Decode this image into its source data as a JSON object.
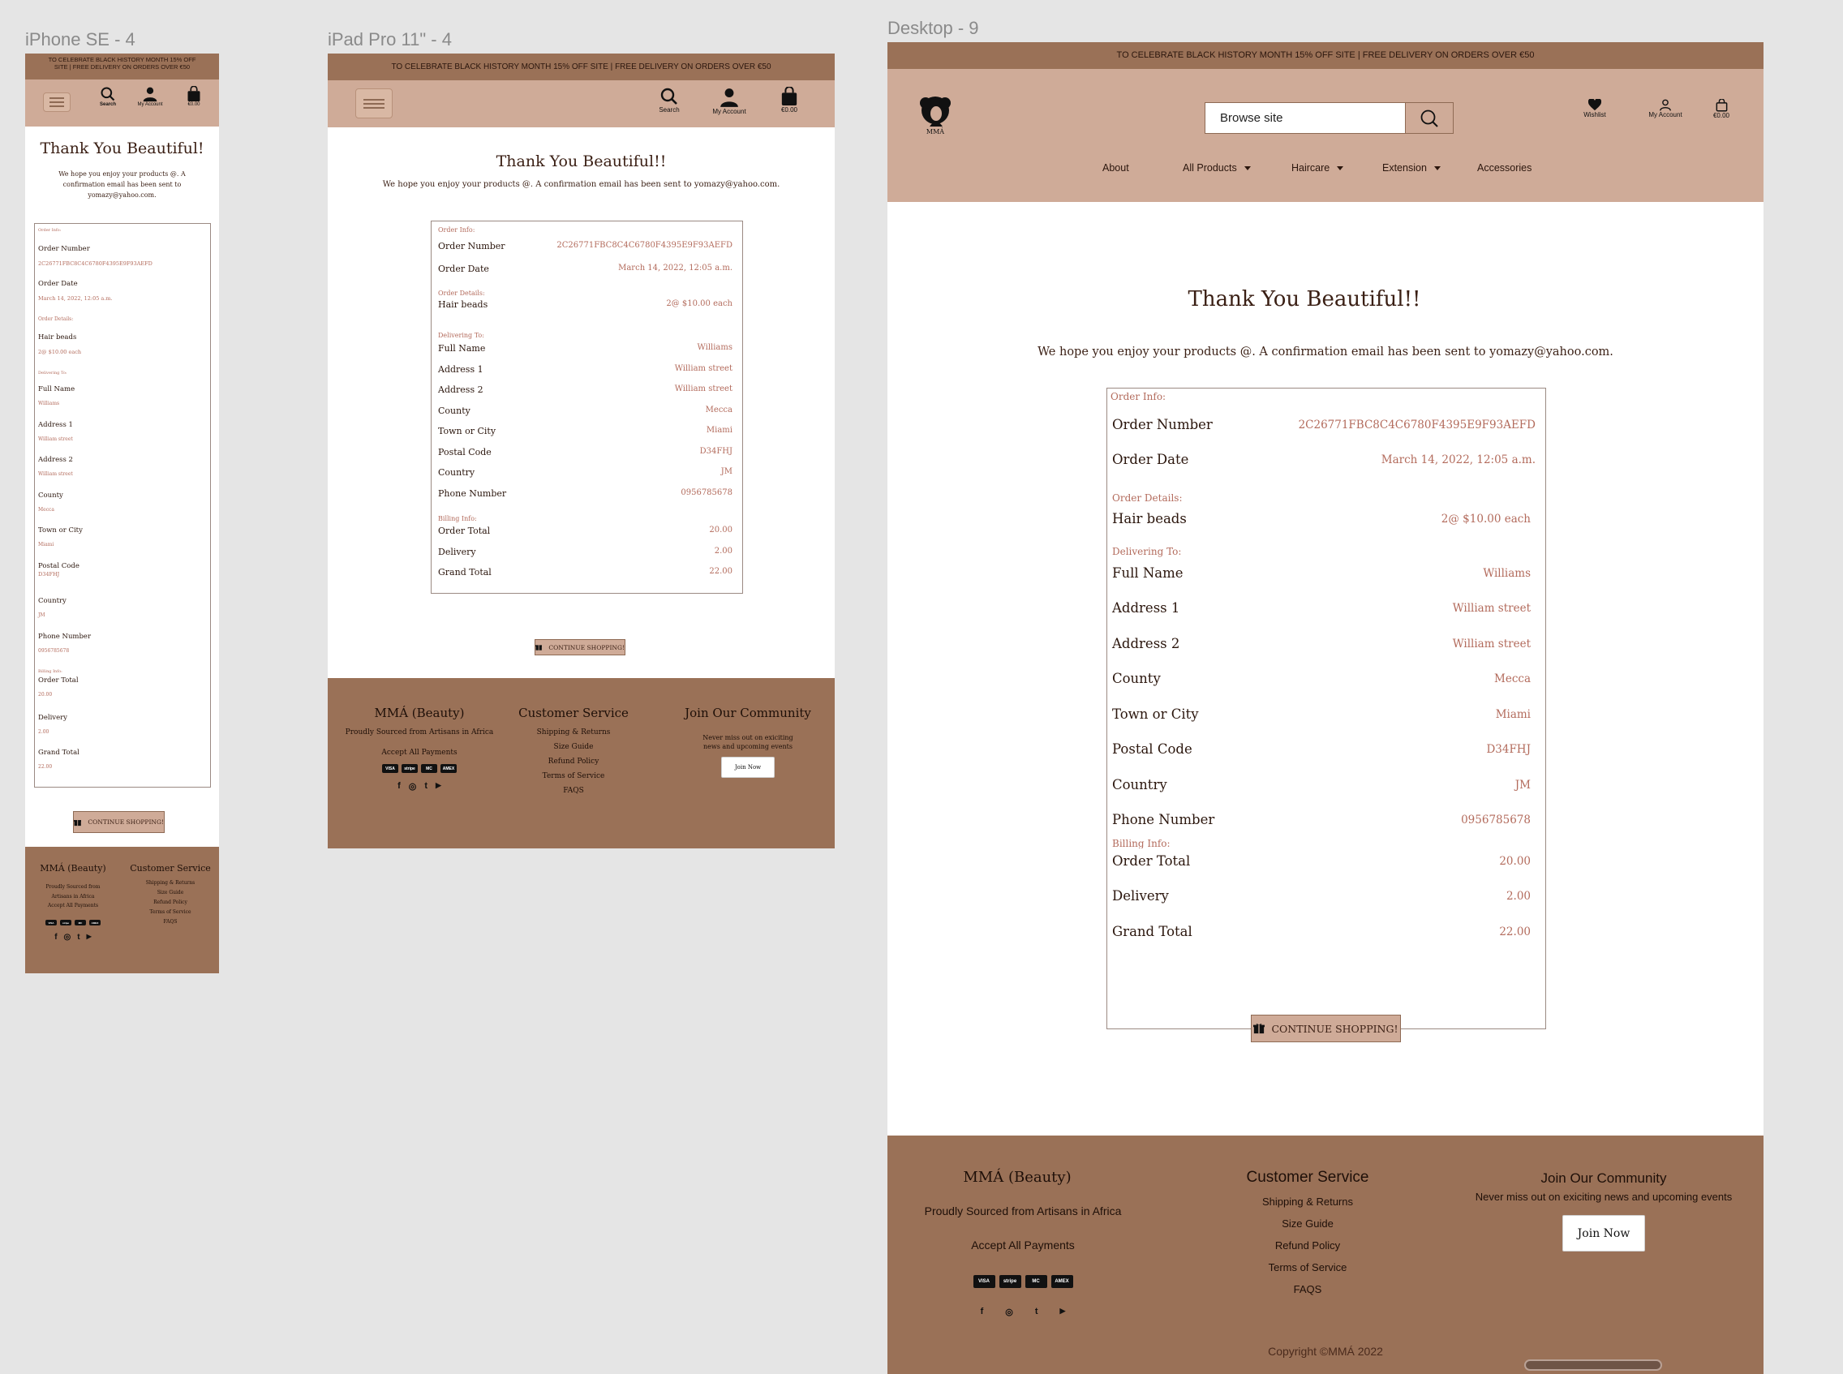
{
  "frames": {
    "mobile": "iPhone SE - 4",
    "tablet": "iPad Pro 11\" - 4",
    "desktop": "Desktop - 9"
  },
  "promo": "TO CELEBRATE BLACK HISTORY MONTH 15% OFF SITE | FREE DELIVERY ON ORDERS OVER €50",
  "header": {
    "search_label": "Search",
    "account_label": "My Account",
    "cart_total": "€0.00",
    "wishlist_label": "Wishlist",
    "search_placeholder": "Browse site",
    "logo_text": "MMÁ"
  },
  "nav": [
    {
      "label": "About",
      "dropdown": false
    },
    {
      "label": "All Products",
      "dropdown": true
    },
    {
      "label": "Haircare",
      "dropdown": true
    },
    {
      "label": "Extension",
      "dropdown": true
    },
    {
      "label": "Accessories",
      "dropdown": false
    }
  ],
  "confirmation": {
    "title": "Thank You Beautiful!!",
    "title_mobile": "Thank You Beautiful!",
    "message": "We hope you enjoy your products @. A confirmation email has been sent to yomazy@yahoo.com."
  },
  "order": {
    "order_info_label": "Order Info:",
    "order_details_label": "Order Details:",
    "delivering_label": "Delivering To:",
    "billing_label": "Billing Info:",
    "order_number_label": "Order Number",
    "order_number": "2C26771FBC8C4C6780F4395E9F93AEFD",
    "order_date_label": "Order Date",
    "order_date": "March 14, 2022, 12:05 a.m.",
    "item_name": "Hair beads",
    "item_qty": "2@ $10.00 each",
    "full_name_label": "Full Name",
    "full_name": "Williams",
    "address1_label": "Address 1",
    "address1": "William street",
    "address2_label": "Address 2",
    "address2": "William street",
    "county_label": "County",
    "county": "Mecca",
    "town_label": "Town or City",
    "town": "Miami",
    "postal_label": "Postal Code",
    "postal": "D34FHJ",
    "country_label": "Country",
    "country": "JM",
    "phone_label": "Phone Number",
    "phone": "0956785678",
    "order_total_label": "Order Total",
    "order_total": "20.00",
    "delivery_label": "Delivery",
    "delivery": "2.00",
    "grand_total_label": "Grand Total",
    "grand_total": "22.00"
  },
  "continue_button": "CONTINUE SHOPPING!",
  "footer": {
    "brand": "MMÁ (Beauty)",
    "tagline": "Proudly Sourced from Artisans in Africa",
    "payments_label": "Accept All Payments",
    "payment_methods": [
      "VISA",
      "stripe",
      "MC",
      "AMEX"
    ],
    "customer_service_title": "Customer Service",
    "links": [
      "Shipping & Returns",
      "Size Guide",
      "Refund Policy",
      "Terms of Service",
      "FAQS"
    ],
    "community_title": "Join Our Community",
    "community_text": "Never miss out on exiciting news and upcoming events",
    "join_button": "Join Now",
    "copyright": "Copyright ©MMÁ 2022",
    "social": [
      "f",
      "◎",
      "t",
      "▶"
    ]
  },
  "colors": {
    "promo_bg": "#9a7157",
    "header_bg": "#cfab98",
    "footer_bg": "#9a7157",
    "value_text": "#b36b5c",
    "heading_text": "#3a1f14"
  }
}
